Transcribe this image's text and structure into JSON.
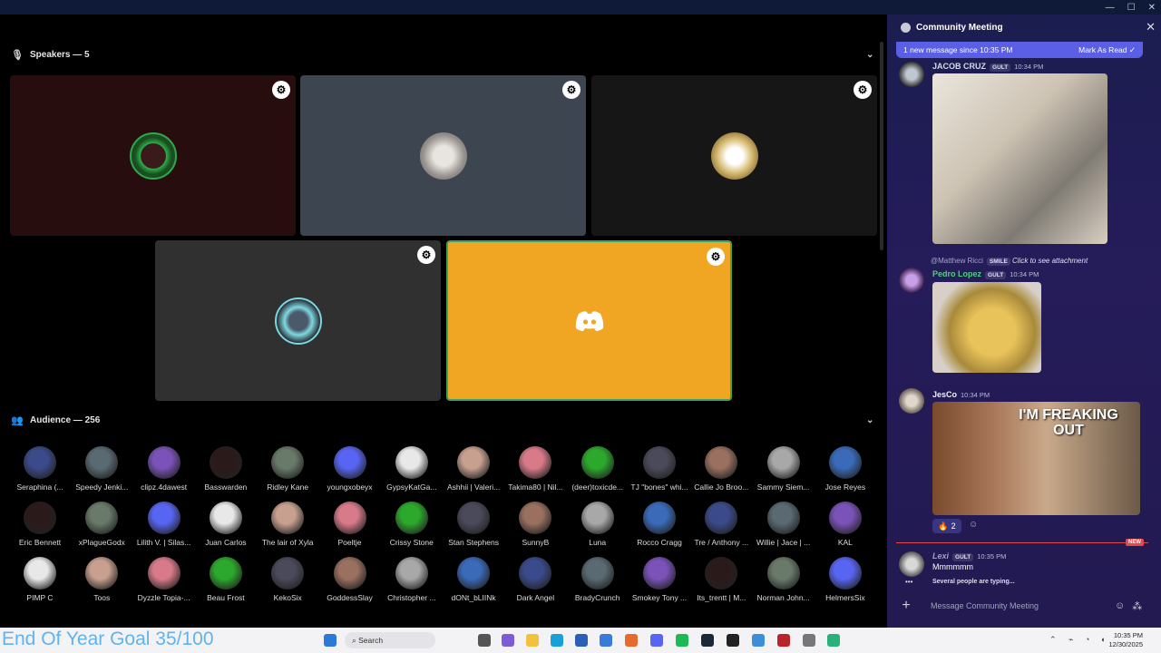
{
  "window": {
    "title": "Community Meeting"
  },
  "speakers": {
    "header": "Speakers — 5"
  },
  "audience": {
    "header": "Audience — 256",
    "members": [
      [
        "Seraphina (...",
        "Speedy Jenki...",
        "clipz.4dawest",
        "Basswarden",
        "Ridley Kane",
        "youngxobeyx",
        "GypsyKatGa...",
        "Ashhii | Valeri...",
        "Takima80 | Nil...",
        "(deer)toxicde...",
        "TJ \"bones\" whi...",
        "Callie Jo Broo...",
        "Sammy Siem...",
        "Jose Reyes"
      ],
      [
        "Eric Bennett",
        "xPlagueGodx",
        "Lilith V. | Silas...",
        "Juan Carlos",
        "The lair of Xyla",
        "Poeltje",
        "Crissy Stone",
        "Stan Stephens",
        "SunnyB",
        "Luna",
        "Rocco Cragg",
        "Tre / Anthony ...",
        "Willie | Jace | ...",
        "KAL"
      ],
      [
        "PIMP C",
        "Toos",
        "Dyzzle Topia-...",
        "Beau Frost",
        "KekoSix",
        "GoddessSlay",
        "Christopher ...",
        "dONt_bLIINk",
        "Dark Angel",
        "BradyCrunch",
        "Smokey Tony ...",
        "Its_trentt | M...",
        "Norman John...",
        "HelmersSix"
      ]
    ]
  },
  "chat": {
    "channel": "Community Meeting",
    "banner_text": "1 new message since 10:35 PM",
    "banner_action": "Mark As Read",
    "messages": [
      {
        "user": "JACOB CRUZ",
        "tag": "GULT",
        "time": "10:34 PM"
      },
      {
        "reply_to": "@Matthew Ricci",
        "reply_tag": "SMILE",
        "reply_text": "Click to see attachment",
        "user": "Pedro Lopez",
        "tag": "GULT",
        "time": "10:34 PM"
      },
      {
        "user": "JesCo",
        "time": "10:34 PM",
        "gif_caption": "I'M FREAKING OUT",
        "reaction_count": "2"
      },
      {
        "user": "Lexi",
        "tag": "GULT",
        "time": "10:35 PM",
        "text": "Mmmmmm",
        "new_badge": "NEW"
      }
    ],
    "typing_text": "Several people are typing...",
    "composer_placeholder": "Message Community Meeting"
  },
  "overlay": {
    "goal_text": "End Of Year Goal 35/100"
  },
  "taskbar": {
    "search_label": "Search",
    "time": "10:35 PM",
    "date": "12/30/2025"
  },
  "colors": {
    "accent": "#5b5fe6",
    "active_speaker": "#f0a523",
    "goal_text": "#5fb3f0"
  }
}
